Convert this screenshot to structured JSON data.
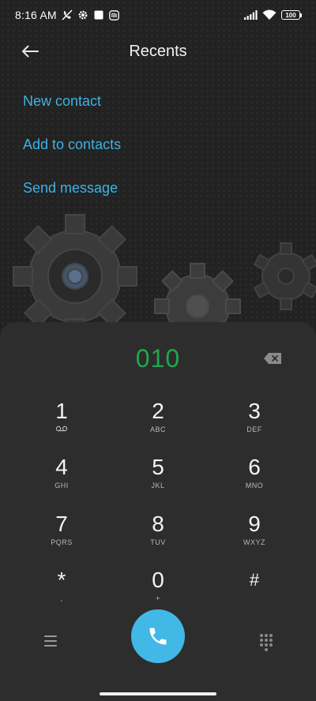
{
  "status_bar": {
    "time": "8:16 AM",
    "battery": "100",
    "icons": [
      "no-call-icon",
      "settings-icon",
      "square-icon",
      "mi-icon",
      "signal-icon",
      "wifi-icon",
      "battery-icon"
    ]
  },
  "header": {
    "title": "Recents",
    "back_icon": "arrow-left-icon"
  },
  "actions": [
    {
      "label": "New contact"
    },
    {
      "label": "Add to contacts"
    },
    {
      "label": "Send message"
    }
  ],
  "dialpad": {
    "number": "010",
    "keys": [
      {
        "digit": "1",
        "letters": ""
      },
      {
        "digit": "2",
        "letters": "ABC"
      },
      {
        "digit": "3",
        "letters": "DEF"
      },
      {
        "digit": "4",
        "letters": "GHI"
      },
      {
        "digit": "5",
        "letters": "JKL"
      },
      {
        "digit": "6",
        "letters": "MNO"
      },
      {
        "digit": "7",
        "letters": "PQRS"
      },
      {
        "digit": "8",
        "letters": "TUV"
      },
      {
        "digit": "9",
        "letters": "WXYZ"
      },
      {
        "digit": "*",
        "letters": ","
      },
      {
        "digit": "0",
        "letters": "+"
      },
      {
        "digit": "#",
        "letters": ""
      }
    ]
  },
  "colors": {
    "accent": "#3cb3e3",
    "number": "#1fa94f",
    "call_button": "#42b8e6",
    "panel": "#2d2d2d"
  }
}
